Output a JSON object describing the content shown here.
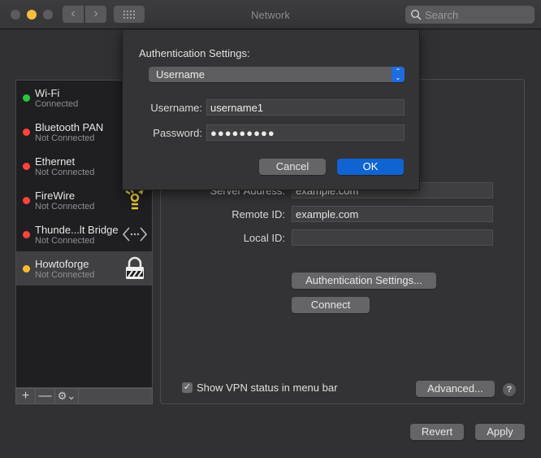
{
  "window": {
    "title": "Network",
    "search_placeholder": "Search"
  },
  "toolbar": {
    "back_glyph": "‹",
    "forward_glyph": "›"
  },
  "sidebar": {
    "services": [
      {
        "name": "Wi-Fi",
        "status": "Connected",
        "dot_color": "#27c93f",
        "icon": "none",
        "selected": false
      },
      {
        "name": "Bluetooth PAN",
        "status": "Not Connected",
        "dot_color": "#ff453a",
        "icon": "none",
        "selected": false
      },
      {
        "name": "Ethernet",
        "status": "Not Connected",
        "dot_color": "#ff453a",
        "icon": "none",
        "selected": false
      },
      {
        "name": "FireWire",
        "status": "Not Connected",
        "dot_color": "#ff453a",
        "icon": "firewire-icon",
        "selected": false
      },
      {
        "name": "Thunde...lt Bridge",
        "status": "Not Connected",
        "dot_color": "#ff453a",
        "icon": "thunderbolt-bridge-icon",
        "selected": false
      },
      {
        "name": "Howtoforge",
        "status": "Not Connected",
        "dot_color": "#febc2e",
        "icon": "vpn-lock-icon",
        "selected": true
      }
    ],
    "footer": {
      "add_label": "+",
      "remove_label": "—",
      "action_label": "⚙︎⌄"
    }
  },
  "panel": {
    "fields": [
      {
        "label": "Server Address:",
        "value": "example.com"
      },
      {
        "label": "Remote ID:",
        "value": "example.com"
      },
      {
        "label": "Local ID:",
        "value": ""
      }
    ],
    "auth_settings_button": "Authentication Settings...",
    "connect_button": "Connect",
    "show_vpn_status": {
      "label": "Show VPN status in menu bar",
      "checked": true,
      "check_glyph": "✓"
    },
    "advanced_button": "Advanced...",
    "help_label": "?"
  },
  "footer": {
    "revert_button": "Revert",
    "apply_button": "Apply"
  },
  "sheet": {
    "heading": "Authentication Settings:",
    "method": {
      "selected": "Username",
      "arrows": "⌃⌄"
    },
    "username": {
      "label": "Username:",
      "value": "username1"
    },
    "password": {
      "label": "Password:",
      "value": "●●●●●●●●●"
    },
    "cancel_button": "Cancel",
    "ok_button": "OK",
    "accent_color": "#0f64d2"
  }
}
